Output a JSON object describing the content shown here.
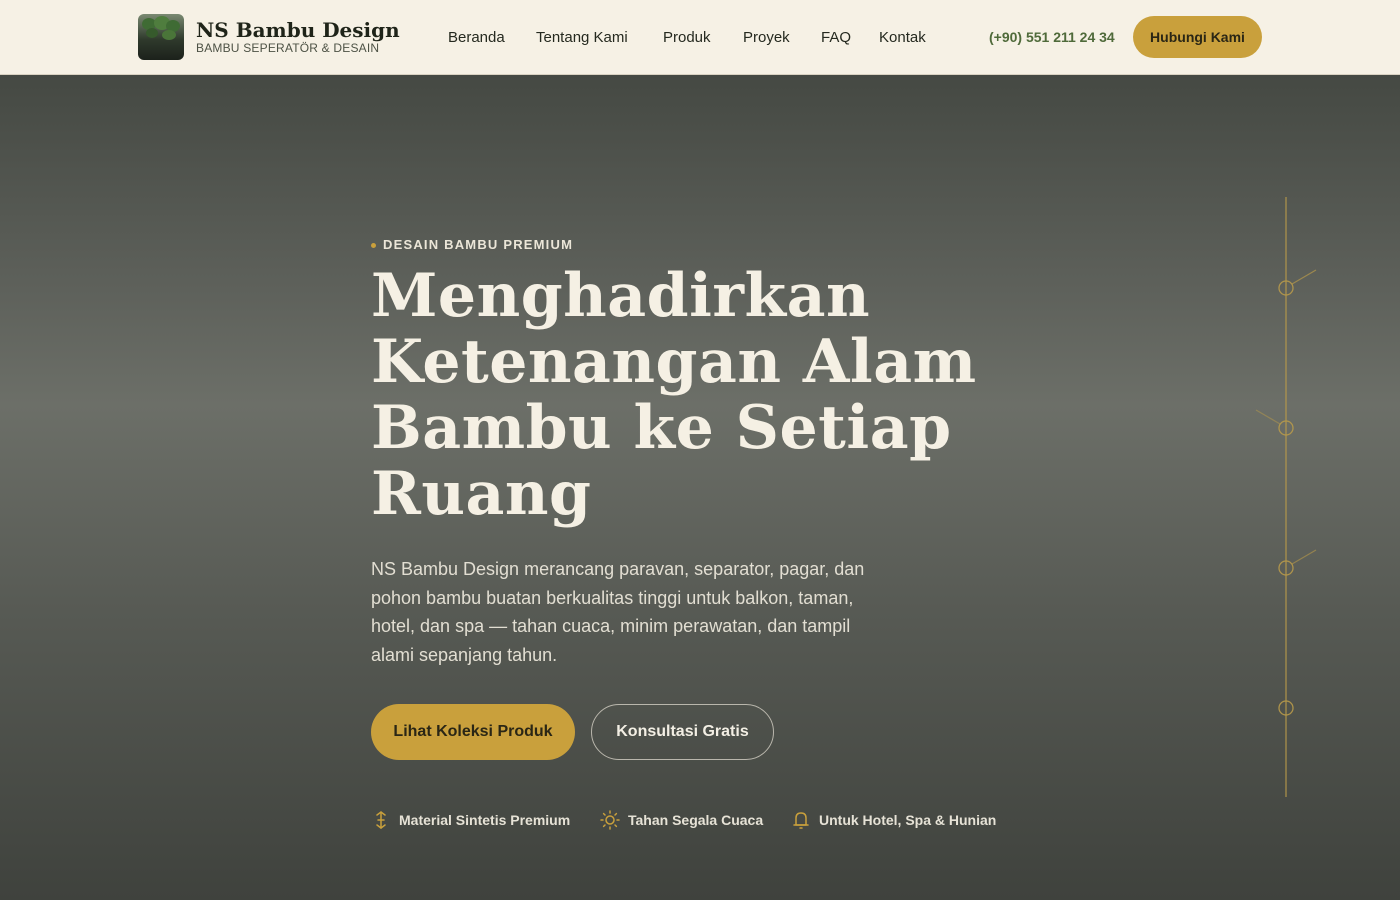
{
  "header": {
    "brand_name": "NS Bambu Design",
    "brand_tagline": "BAMBU SEPERATÖR & DESAIN",
    "nav": [
      {
        "label": "Beranda"
      },
      {
        "label": "Tentang Kami"
      },
      {
        "label": "Produk"
      },
      {
        "label": "Proyek"
      },
      {
        "label": "FAQ"
      },
      {
        "label": "Kontak"
      }
    ],
    "phone": "(+90) 551 211 24 34",
    "cta_label": "Hubungi Kami"
  },
  "hero": {
    "eyebrow": "DESAIN BAMBU PREMIUM",
    "headline": "Menghadirkan Ketenangan Alam Bambu ke Setiap Ruang",
    "lede": "NS Bambu Design merancang paravan, separator, pagar, dan pohon bambu buatan berkualitas tinggi untuk balkon, taman, hotel, dan spa — tahan cuaca, minim perawatan, dan tampil alami sepanjang tahun.",
    "primary_cta": "Lihat Koleksi Produk",
    "secondary_cta": "Konsultasi Gratis",
    "features": [
      {
        "icon": "bamboo-icon",
        "label": "Material Sintetis Premium"
      },
      {
        "icon": "sun-icon",
        "label": "Tahan Segala Cuaca"
      },
      {
        "icon": "bell-icon",
        "label": "Untuk Hotel, Spa & Hunian"
      }
    ]
  },
  "colors": {
    "accent": "#c9a03c",
    "header_bg": "#f6f1e5",
    "hero_bg": "#5d605a",
    "phone_text": "#4f6a3a"
  }
}
